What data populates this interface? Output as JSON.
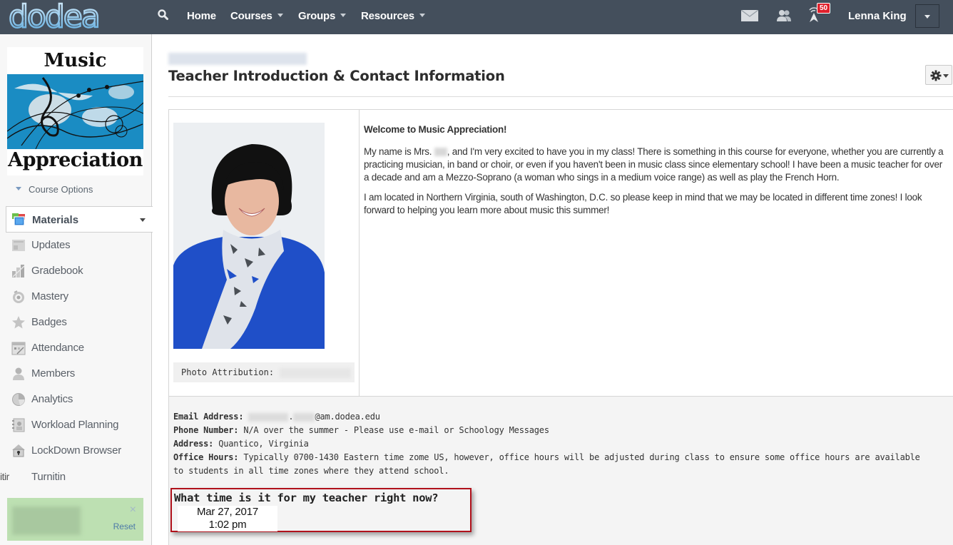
{
  "topbar": {
    "logo_text": "dodea",
    "nav": [
      {
        "label": "Home",
        "has_dropdown": false
      },
      {
        "label": "Courses",
        "has_dropdown": true
      },
      {
        "label": "Groups",
        "has_dropdown": true
      },
      {
        "label": "Resources",
        "has_dropdown": true
      }
    ],
    "icons": [
      "search-icon",
      "mail-icon",
      "connections-icon",
      "notifications-icon"
    ],
    "notification_count": "50",
    "user_name": "Lenna King"
  },
  "sidebar": {
    "course_image": {
      "line1": "Music",
      "line2": "Appreciation"
    },
    "course_options_label": "Course Options",
    "materials_label": "Materials",
    "items": [
      {
        "label": "Updates",
        "icon": "updates-icon"
      },
      {
        "label": "Gradebook",
        "icon": "gradebook-icon"
      },
      {
        "label": "Mastery",
        "icon": "mastery-icon"
      },
      {
        "label": "Badges",
        "icon": "badges-icon"
      },
      {
        "label": "Attendance",
        "icon": "attendance-icon"
      },
      {
        "label": "Members",
        "icon": "members-icon"
      },
      {
        "label": "Analytics",
        "icon": "analytics-icon"
      },
      {
        "label": "Workload Planning",
        "icon": "workload-planning-icon"
      },
      {
        "label": "LockDown Browser",
        "icon": "lockdown-browser-icon"
      },
      {
        "label": "Turnitin",
        "icon": "turnitin-icon",
        "icon_text": "itir"
      }
    ],
    "notice": {
      "close_label": "×",
      "reset_label": "Reset"
    }
  },
  "main": {
    "page_title": "Teacher Introduction & Contact Information",
    "photo_attribution_label": "Photo Attribution:",
    "intro": {
      "welcome": "Welcome to Music Appreciation!",
      "p1_before_name": "My name is Mrs. ",
      "p1_after_name": ", and I'm very excited to have you in my class!  There is something in this course for everyone, whether you are currently a practicing musician, in band or choir, or even if you haven't been in music class since elementary school!  I have been a music teacher for over a decade and am a Mezzo-Soprano (a woman who sings in a medium voice range) as well as play the French Horn.",
      "p2": "I am located in Northern Virginia, south of Washington, D.C. so please keep in mind that we may be located in different time zones!  I look forward to helping you learn more about music this summer!"
    },
    "contact": {
      "email_label": "Email Address:",
      "email_separator": ".",
      "email_domain": "@am.dodea.edu",
      "phone_label": "Phone Number:",
      "phone_value": " N/A over the summer - Please use e-mail or Schoology Messages",
      "address_label": "Address:",
      "address_value": " Quantico, Virginia",
      "office_hours_label": "Office Hours:",
      "office_hours_value": " Typically 0700-1430 Eastern time zome US, however, office hours will be adjusted during class to ensure some office hours are available to students in all time zones where they attend school."
    },
    "clock": {
      "question": "What time is it for my teacher right now?",
      "date": "Mar 27, 2017",
      "time": "1:02 pm"
    }
  },
  "colors": {
    "topbar_bg": "#444f5c",
    "badge_red": "#e0202c",
    "notice_green": "#bde0b2",
    "clock_border": "#b0111b",
    "link_blue": "#4d7aa8"
  }
}
